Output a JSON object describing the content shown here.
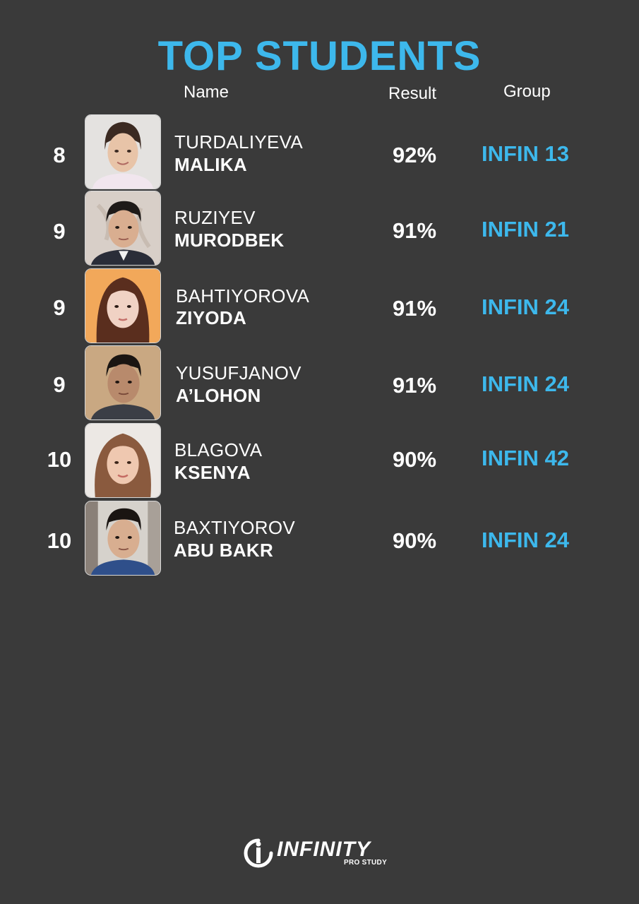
{
  "title": "TOP STUDENTS",
  "columns": {
    "name": "Name",
    "result": "Result",
    "group": "Group"
  },
  "students": [
    {
      "rank": "8",
      "surname": "TURDALIYEVA",
      "firstname": "MALIKA",
      "result": "92%",
      "group": "INFIN 13"
    },
    {
      "rank": "9",
      "surname": "RUZIYEV",
      "firstname": "MURODBEK",
      "result": "91%",
      "group": "INFIN 21"
    },
    {
      "rank": "9",
      "surname": "BAHTIYOROVA",
      "firstname": "ZIYODA",
      "result": "91%",
      "group": "INFIN 24"
    },
    {
      "rank": "9",
      "surname": "YUSUFJANOV",
      "firstname": "A’LOHON",
      "result": "91%",
      "group": "INFIN 24"
    },
    {
      "rank": "10",
      "surname": "BLAGOVA",
      "firstname": "KSENYA",
      "result": "90%",
      "group": "INFIN 42"
    },
    {
      "rank": "10",
      "surname": "BAXTIYOROV",
      "firstname": "ABU BAKR",
      "result": "90%",
      "group": "INFIN 24"
    }
  ],
  "logo": {
    "name": "INFINITY",
    "tagline": "PRO STUDY"
  },
  "colors": {
    "background": "#3a3a3a",
    "accent": "#3db8ec",
    "text": "#ffffff"
  }
}
